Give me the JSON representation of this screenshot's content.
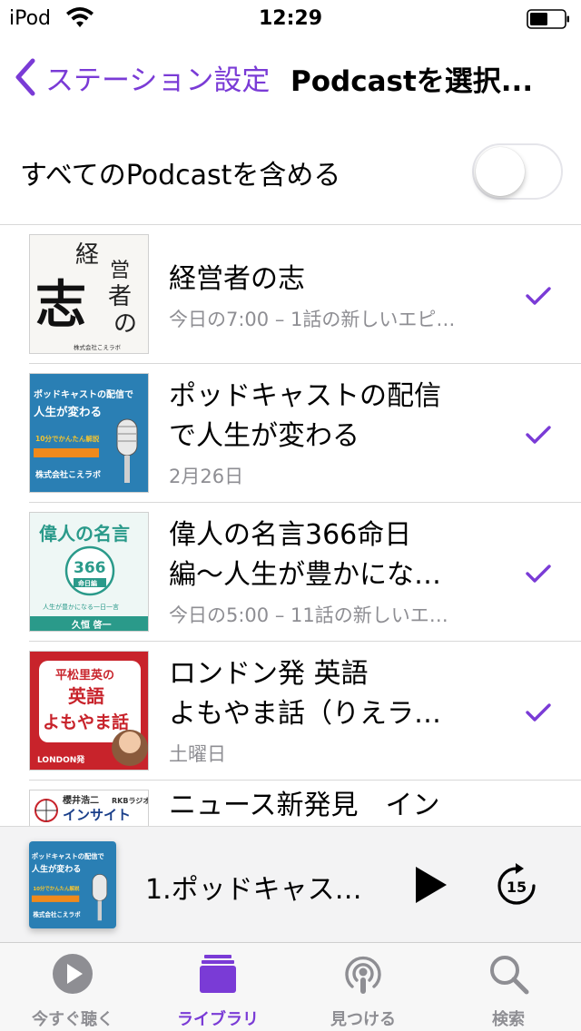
{
  "status": {
    "carrier": "iPod",
    "time": "12:29"
  },
  "nav": {
    "back_label": "ステーション設定",
    "title": "Podcastを選択..."
  },
  "toggle": {
    "label": "すべてのPodcastを含める",
    "on": false
  },
  "accent": "#7a3bd6",
  "podcasts": [
    {
      "title1": "経営者の志",
      "title2": "",
      "sub": "今日の7:00 – 1話の新しいエピ…",
      "checked": true,
      "art_text": {
        "a": "経",
        "b": "営",
        "c": "者",
        "d": "志",
        "e": "の",
        "f": "株式会社こえラボ"
      }
    },
    {
      "title1": "ポッドキャストの配信",
      "title2": "で人生が変わる",
      "sub": "2月26日",
      "checked": true,
      "art_text": {
        "a": "ポッドキャストの配信で",
        "b": "人生が変わる",
        "c": "10分でかんたん解説",
        "d": "株式会社こえラボ"
      }
    },
    {
      "title1": "偉人の名言366命日",
      "title2": "編〜人生が豊かにな…",
      "sub": "今日の5:00 – 11話の新しいエ…",
      "checked": true,
      "art_text": {
        "a": "偉人の名言",
        "b": "366",
        "c": "命日編",
        "d": "人生が豊かになる一日一言",
        "e": "久恒 啓一"
      }
    },
    {
      "title1": "ロンドン発 英語",
      "title2": "よもやま話（りえラ…",
      "sub": "土曜日",
      "checked": true,
      "art_text": {
        "a": "平松里英の",
        "b": "英語",
        "c": "よもやま話",
        "d": "LONDON発"
      }
    },
    {
      "title1": "ニュース新発見　イン",
      "title2": "",
      "sub": "",
      "checked": false,
      "art_text": {
        "a": "櫻井浩二",
        "b": "RKBラジオ",
        "c": "インサイト"
      }
    }
  ],
  "player": {
    "title": "1.ポッドキャス…",
    "skip_seconds": "15",
    "art_text": {
      "a": "ポッドキャストの配信で",
      "b": "人生が変わる",
      "c": "10分でかんたん解説",
      "d": "株式会社こえラボ"
    }
  },
  "tabs": [
    {
      "label": "今すぐ聴く",
      "icon": "play-circle-icon",
      "active": false
    },
    {
      "label": "ライブラリ",
      "icon": "library-icon",
      "active": true
    },
    {
      "label": "見つける",
      "icon": "podcast-broadcast-icon",
      "active": false
    },
    {
      "label": "検索",
      "icon": "search-icon",
      "active": false
    }
  ]
}
